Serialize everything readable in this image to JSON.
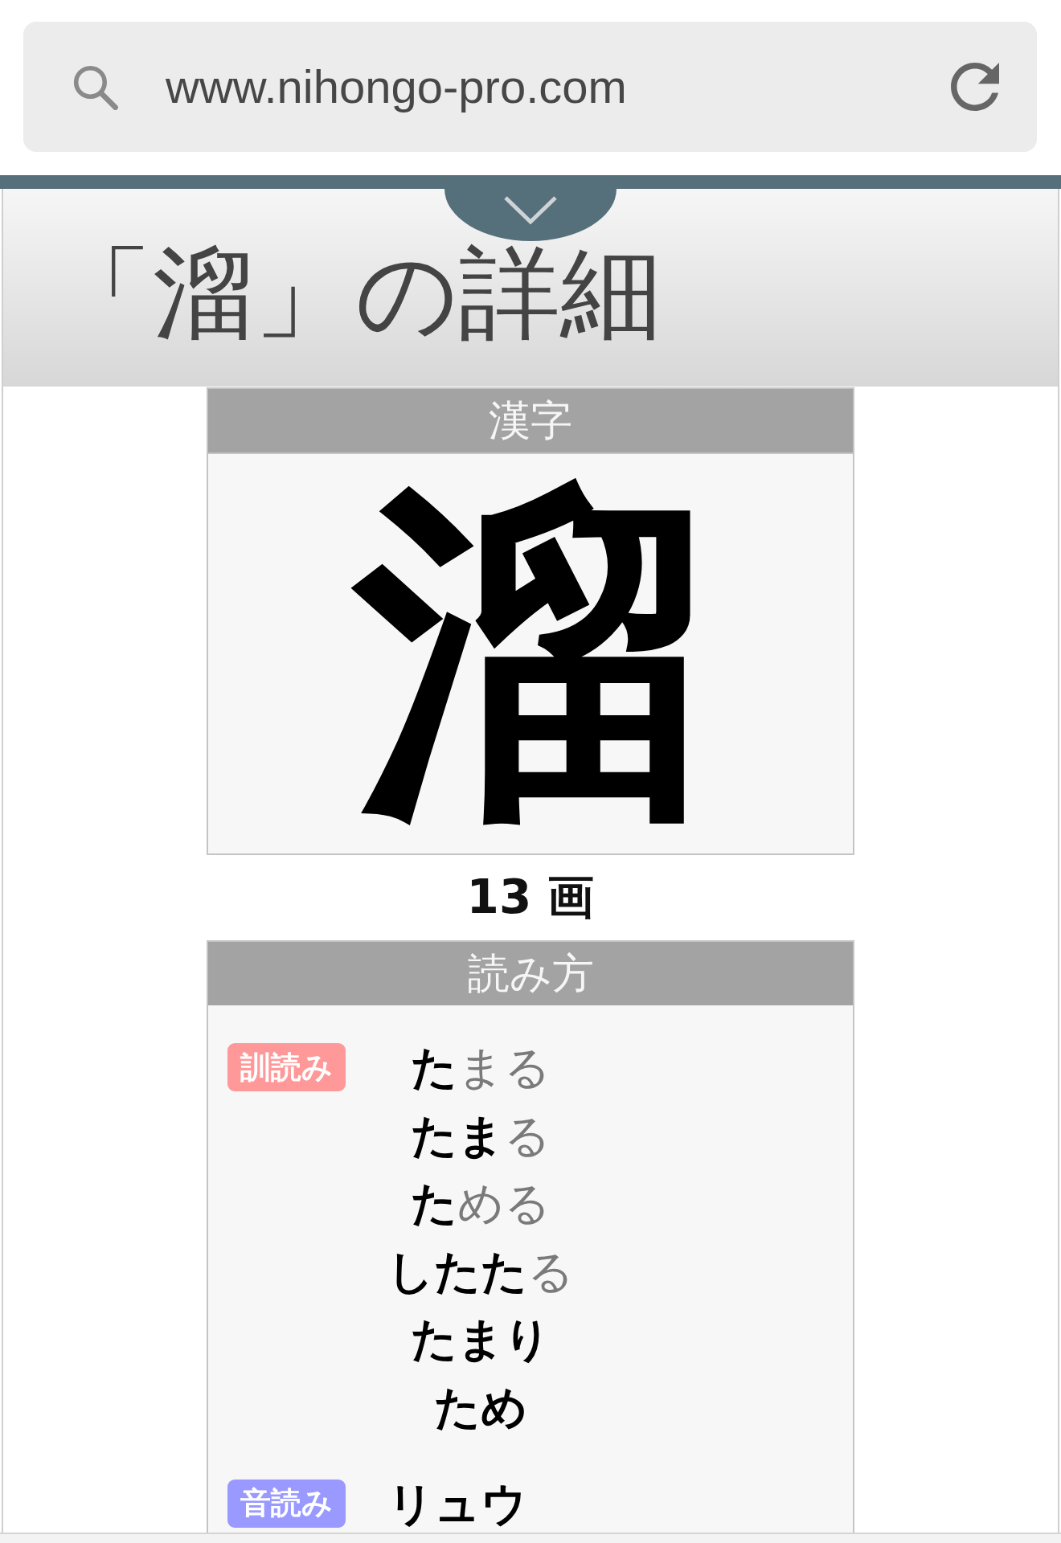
{
  "address_bar": {
    "value": "www.nihongo-pro.com"
  },
  "page_title": "「溜」の詳細",
  "kanji_section": {
    "heading": "漢字",
    "kanji": "溜",
    "stroke_count": "13 画"
  },
  "readings_section": {
    "heading": "読み方",
    "groups": [
      {
        "label": "訓読み",
        "color": "#ff9999",
        "readings": [
          "**た**まる",
          "**たま**る",
          "**た**める",
          "**したた**る",
          "たまり",
          "ため"
        ]
      },
      {
        "label": "音読み",
        "color": "#9999ff",
        "readings": [
          "リュウ"
        ]
      }
    ]
  }
}
